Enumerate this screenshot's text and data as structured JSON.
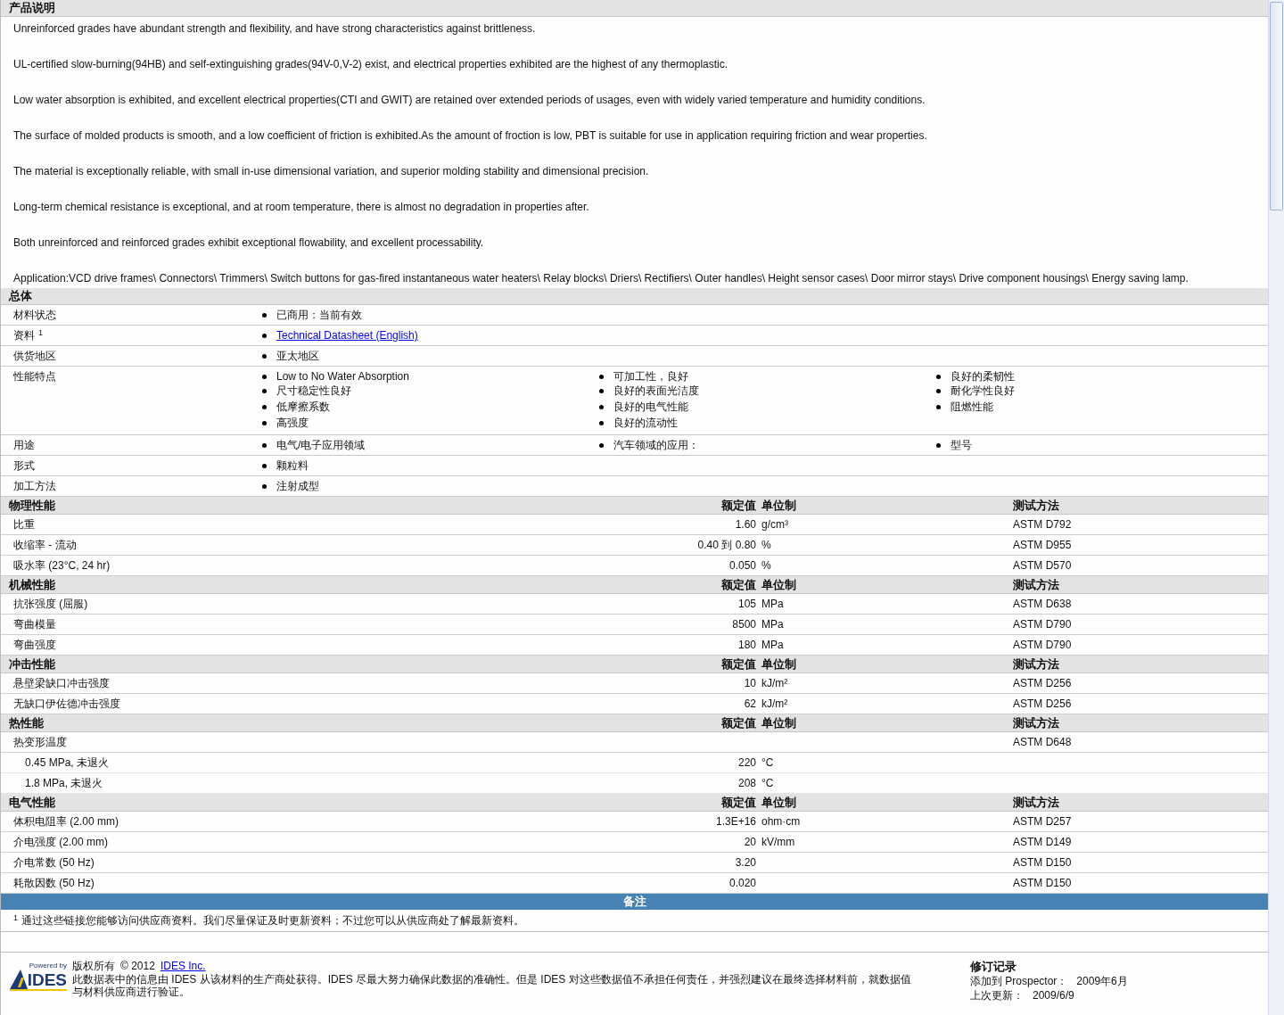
{
  "description": {
    "title": "产品说明",
    "paragraphs": [
      "Unreinforced grades have abundant strength and flexibility, and have strong characteristics against brittleness.",
      "UL-certified slow-burning(94HB) and self-extinguishing grades(94V-0,V-2) exist, and electrical properties exhibited are the highest of any thermoplastic.",
      "Low water absorption is exhibited, and excellent electrical properties(CTI and GWIT) are retained over extended periods of usages, even with widely varied temperature and humidity conditions.",
      "The surface of molded products is smooth, and a low coefficient of friction is exhibited.As the amount of froction is low, PBT is suitable for use in application requiring friction and wear properties.",
      "The material is exceptionally reliable, with small in-use dimensional variation, and superior molding stability and dimensional precision.",
      "Long-term chemical resistance is exceptional, and at room temperature, there is almost no degradation in properties after.",
      "Both unreinforced and reinforced grades exhibit exceptional flowability, and excellent processability.",
      "Application:VCD drive frames\\ Connectors\\ Trimmers\\ Switch buttons for gas-fired instantaneous water heaters\\ Relay blocks\\ Driers\\ Rectifiers\\ Outer handles\\ Height sensor cases\\ Door mirror stays\\ Drive component housings\\ Energy saving lamp."
    ]
  },
  "general": {
    "title": "总体",
    "rows": [
      {
        "label": "材料状态",
        "kind": "list",
        "columns": [
          [
            "已商用：当前有效"
          ]
        ]
      },
      {
        "label": "资料",
        "note": "1",
        "kind": "link",
        "columns": [
          [
            "Technical Datasheet (English)"
          ]
        ]
      },
      {
        "label": "供货地区",
        "kind": "list",
        "columns": [
          [
            "亚太地区"
          ]
        ]
      },
      {
        "label": "性能特点",
        "kind": "list",
        "columns": [
          [
            "Low to No Water Absorption",
            "尺寸稳定性良好",
            "低摩擦系数",
            "高强度"
          ],
          [
            "可加工性，良好",
            "良好的表面光洁度",
            "良好的电气性能",
            "良好的流动性"
          ],
          [
            "良好的柔韧性",
            "耐化学性良好",
            "阻燃性能"
          ]
        ]
      },
      {
        "label": "用途",
        "kind": "list",
        "columns": [
          [
            "电气/电子应用领域"
          ],
          [
            "汽车领域的应用："
          ],
          [
            "型号"
          ]
        ]
      },
      {
        "label": "形式",
        "kind": "list",
        "columns": [
          [
            "颗粒料"
          ]
        ]
      },
      {
        "label": "加工方法",
        "kind": "list",
        "columns": [
          [
            "注射成型"
          ]
        ]
      }
    ]
  },
  "property_sections": [
    {
      "title": "物理性能",
      "headers": [
        "额定值",
        "单位制",
        "测试方法"
      ],
      "rows": [
        {
          "name": "比重",
          "value": "1.60",
          "unit": "g/cm³",
          "method": "ASTM D792"
        },
        {
          "name": "收缩率 - 流动",
          "value": "0.40 到 0.80",
          "unit": "%",
          "method": "ASTM D955"
        },
        {
          "name": "吸水率 (23°C, 24 hr)",
          "value": "0.050",
          "unit": "%",
          "method": "ASTM D570"
        }
      ]
    },
    {
      "title": "机械性能",
      "headers": [
        "额定值",
        "单位制",
        "测试方法"
      ],
      "rows": [
        {
          "name": "抗张强度 (屈服)",
          "value": "105",
          "unit": "MPa",
          "method": "ASTM D638"
        },
        {
          "name": "弯曲模量",
          "value": "8500",
          "unit": "MPa",
          "method": "ASTM D790"
        },
        {
          "name": "弯曲强度",
          "value": "180",
          "unit": "MPa",
          "method": "ASTM D790"
        }
      ]
    },
    {
      "title": "冲击性能",
      "headers": [
        "额定值",
        "单位制",
        "测试方法"
      ],
      "rows": [
        {
          "name": "悬壁梁缺口冲击强度",
          "value": "10",
          "unit": "kJ/m²",
          "method": "ASTM D256"
        },
        {
          "name": "无缺口伊佐德冲击强度",
          "value": "62",
          "unit": "kJ/m²",
          "method": "ASTM D256"
        }
      ]
    },
    {
      "title": "热性能",
      "headers": [
        "额定值",
        "单位制",
        "测试方法"
      ],
      "rows": [
        {
          "name": "热变形温度",
          "method": "ASTM D648",
          "children": [
            {
              "name": "0.45 MPa, 未退火",
              "value": "220",
              "unit": "°C"
            },
            {
              "name": "1.8 MPa, 未退火",
              "value": "208",
              "unit": "°C"
            }
          ]
        }
      ]
    },
    {
      "title": "电气性能",
      "headers": [
        "额定值",
        "单位制",
        "测试方法"
      ],
      "rows": [
        {
          "name": "体积电阻率 (2.00 mm)",
          "value": "1.3E+16",
          "unit": "ohm·cm",
          "method": "ASTM D257"
        },
        {
          "name": "介电强度 (2.00 mm)",
          "value": "20",
          "unit": "kV/mm",
          "method": "ASTM D149"
        },
        {
          "name": "介电常数 (50 Hz)",
          "value": "3.20",
          "method": "ASTM D150"
        },
        {
          "name": "耗散因数 (50 Hz)",
          "value": "0.020",
          "method": "ASTM D150"
        }
      ]
    }
  ],
  "notes": {
    "title": "备注",
    "items": [
      {
        "mark": "1",
        "text": "通过这些链接您能够访问供应商资料。我们尽量保证及时更新资料；不过您可以从供应商处了解最新资料。"
      }
    ]
  },
  "footer": {
    "logo_caption": "Powered by",
    "logo_text": "IDES",
    "copyright_label": "版权所有",
    "copyright_year": "© 2012",
    "copyright_link": "IDES Inc.",
    "disclaimer": "此数据表中的信息由 IDES 从该材料的生产商处获得。IDES 尽最大努力确保此数据的准确性。但是 IDES 对这些数据值不承担任何责任，并强烈建议在最终选择材料前，就数据值与材料供应商进行验证。",
    "revision": {
      "title": "修订记录",
      "lines": [
        {
          "label": "添加到 Prospector：",
          "value": "2009年6月"
        },
        {
          "label": "上次更新：",
          "value": "2009/6/9"
        }
      ]
    }
  }
}
